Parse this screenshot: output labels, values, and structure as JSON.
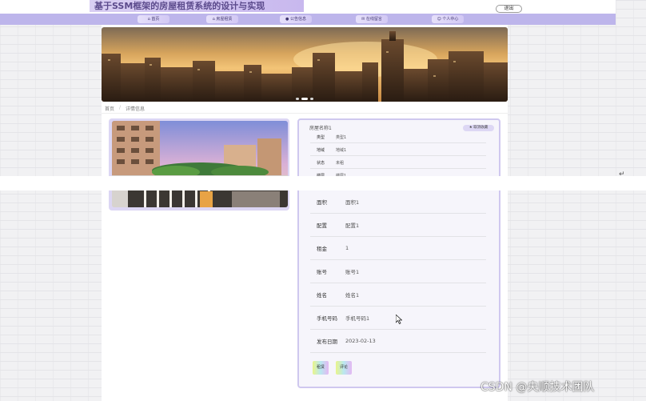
{
  "header": {
    "site_title": "基于SSM框架的房屋租赁系统的设计与实现",
    "logout_label": "退出"
  },
  "nav": {
    "items": [
      {
        "label": "首页",
        "icon": "home-icon"
      },
      {
        "label": "房屋租赁",
        "icon": "house-icon"
      },
      {
        "label": "公告信息",
        "icon": "notice-icon"
      },
      {
        "label": "在线留言",
        "icon": "message-icon"
      },
      {
        "label": "个人中心",
        "icon": "user-icon"
      }
    ]
  },
  "banner": {
    "slide_count": 3,
    "active_slide": 2
  },
  "breadcrumb": {
    "home": "首页",
    "current": "详情信息"
  },
  "detail": {
    "title": "房屋名称1",
    "collect_label": "★ 取消收藏",
    "small_fields": [
      {
        "label": "类型",
        "value": "类型1"
      },
      {
        "label": "地域",
        "value": "地域1"
      },
      {
        "label": "状态",
        "value": "未租"
      },
      {
        "label": "楼层",
        "value": "楼层1"
      }
    ],
    "fields": [
      {
        "label": "面积",
        "value": "面积1"
      },
      {
        "label": "配置",
        "value": "配置1"
      },
      {
        "label": "租金",
        "value": "1"
      },
      {
        "label": "账号",
        "value": "账号1"
      },
      {
        "label": "姓名",
        "value": "姓名1"
      },
      {
        "label": "手机号码",
        "value": "手机号码1"
      },
      {
        "label": "发布日期",
        "value": "2023-02-13"
      }
    ],
    "actions": [
      {
        "label": "租赁"
      },
      {
        "label": "评论"
      }
    ]
  },
  "overlay": {
    "return_mark": "↵"
  },
  "watermark": "CSDN @央顺技术团队",
  "colors": {
    "nav_bar": "#bdb5eb",
    "panel_border": "#cfc8ef",
    "title_text": "#5b4a8c"
  }
}
